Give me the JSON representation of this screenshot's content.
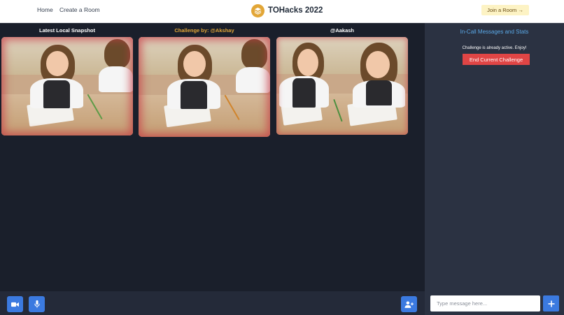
{
  "header": {
    "nav": [
      {
        "label": "Home"
      },
      {
        "label": "Create a Room"
      }
    ],
    "brand_title": "TOHacks 2022",
    "join_label": "Join a Room →"
  },
  "stage": {
    "tiles": [
      {
        "label": "Latest Local Snapshot",
        "label_color": "#ffffff"
      },
      {
        "label": "Challenge by: @Akshay",
        "label_color": "#e2a637"
      },
      {
        "label": "@Aakash",
        "label_color": "#ffffff"
      }
    ]
  },
  "controls": {
    "video_icon": "video-camera-icon",
    "mic_icon": "microphone-icon",
    "invite_icon": "add-user-icon"
  },
  "side": {
    "title": "In-Call Messages and Stats",
    "status": "Challenge is already active. Enjoy!",
    "end_button": "End Current Challenge",
    "message_placeholder": "Type message here...",
    "send_icon": "plus-icon"
  },
  "colors": {
    "accent_blue": "#3b7ae0",
    "danger_red": "#e04545",
    "brand_gold": "#e2a637",
    "panel_bg": "#2b3242",
    "stage_bg": "#1a1f2b"
  }
}
